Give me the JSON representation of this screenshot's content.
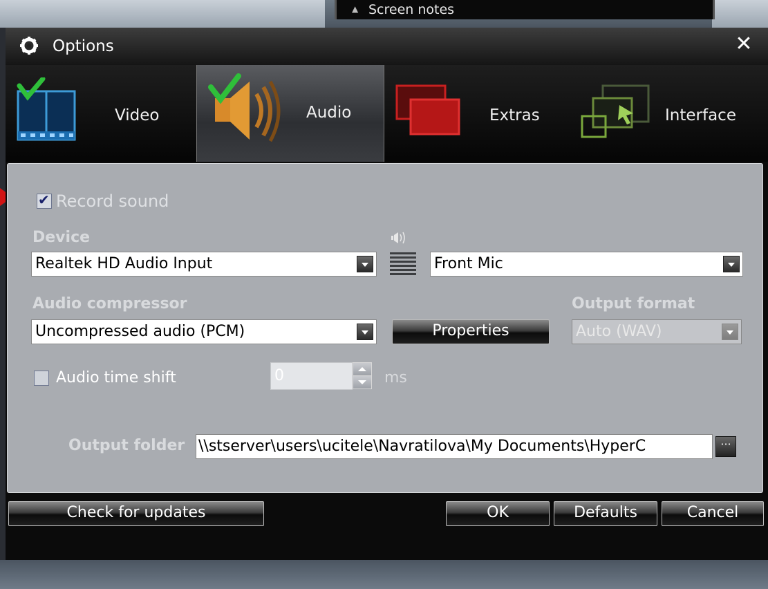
{
  "screen_notes": {
    "label": "Screen notes"
  },
  "window": {
    "title": "Options",
    "close_glyph": "✕"
  },
  "tabs": [
    {
      "label": "Video",
      "icon": "film-icon",
      "active": false
    },
    {
      "label": "Audio",
      "icon": "speaker-icon",
      "active": true
    },
    {
      "label": "Extras",
      "icon": "extras-icon",
      "active": false
    },
    {
      "label": "Interface",
      "icon": "interface-icon",
      "active": false
    }
  ],
  "audio": {
    "record_sound": {
      "label": "Record sound",
      "checked": true
    },
    "device": {
      "label": "Device",
      "value": "Realtek HD Audio Input"
    },
    "input_line": {
      "value": "Front Mic"
    },
    "compressor": {
      "label": "Audio compressor",
      "value": "Uncompressed audio (PCM)"
    },
    "properties_button": "Properties",
    "output_format": {
      "label": "Output format",
      "value": "Auto (WAV)"
    },
    "time_shift": {
      "label": "Audio time shift",
      "checked": false,
      "value": "0",
      "unit": "ms"
    },
    "output_folder": {
      "label": "Output folder",
      "value": "\\\\stserver\\users\\ucitele\\Navratilova\\My Documents\\HyperC"
    },
    "browse_button": "···"
  },
  "footer": {
    "check_updates": "Check for updates",
    "ok": "OK",
    "defaults": "Defaults",
    "cancel": "Cancel"
  },
  "colors": {
    "accent_red": "#d21414",
    "panel": "#a9acb1",
    "window": "#0b0b0b"
  }
}
